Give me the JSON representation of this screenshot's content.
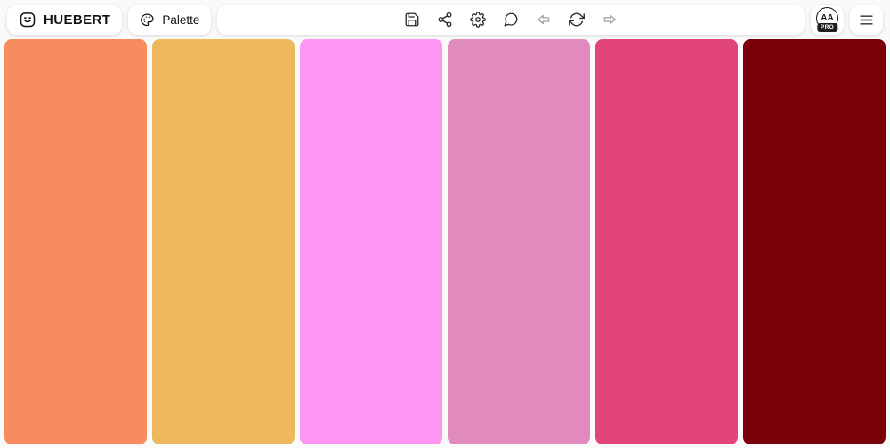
{
  "header": {
    "logo": {
      "label": "HUEBERT",
      "icon": "smiley-face-icon"
    },
    "palette_button": {
      "label": "Palette",
      "icon": "palette-icon"
    },
    "toolbar": {
      "buttons": [
        {
          "name": "save",
          "icon": "save-icon",
          "enabled": true
        },
        {
          "name": "share",
          "icon": "share-icon",
          "enabled": true
        },
        {
          "name": "settings",
          "icon": "gear-icon",
          "enabled": true
        },
        {
          "name": "feedback",
          "icon": "chat-bubble-icon",
          "enabled": true
        },
        {
          "name": "undo",
          "icon": "arrow-left-icon",
          "enabled": false
        },
        {
          "name": "regenerate",
          "icon": "refresh-icon",
          "enabled": true
        },
        {
          "name": "redo",
          "icon": "arrow-right-icon",
          "enabled": false
        }
      ]
    },
    "contrast_button": {
      "label": "AA",
      "badge": "PRO",
      "icon": "contrast-checker-icon"
    },
    "menu_button": {
      "icon": "hamburger-icon"
    }
  },
  "palette": {
    "swatches": [
      {
        "color": "#F88C5E"
      },
      {
        "color": "#EDB95C"
      },
      {
        "color": "#FC96F2"
      },
      {
        "color": "#E18ABD"
      },
      {
        "color": "#E24679"
      },
      {
        "color": "#7A0107"
      }
    ]
  }
}
